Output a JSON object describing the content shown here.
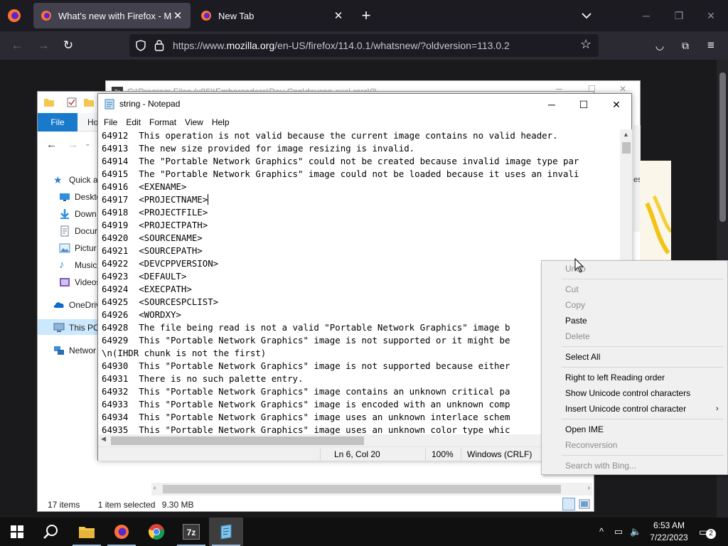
{
  "firefox": {
    "tabs": [
      {
        "title": "What's new with Firefox - More"
      },
      {
        "title": "New Tab"
      }
    ],
    "url_prefix": "https://www.",
    "url_host": "mozilla.org",
    "url_path": "/en-US/firefox/114.0.1/whatsnew/?oldversion=113.0.2"
  },
  "zip": {
    "title": "C:\\Program Files (x86)\\Embarcadero\\Dev-Cpp\\devcpp.exe\\.rsrc\\0\\",
    "icon_text": "7z",
    "side_text": "es"
  },
  "explorer": {
    "file_tab": "File",
    "home_tab": "Ho",
    "nav": [
      {
        "label": "Quick a",
        "icon": "star-icon"
      },
      {
        "label": "Deskto",
        "icon": "desktop-icon"
      },
      {
        "label": "Down",
        "icon": "download-icon"
      },
      {
        "label": "Docur",
        "icon": "documents-icon"
      },
      {
        "label": "Pictur",
        "icon": "pictures-icon"
      },
      {
        "label": "Music",
        "icon": "music-icon"
      },
      {
        "label": "Videos",
        "icon": "videos-icon"
      },
      {
        "label": "OneDriv",
        "icon": "onedrive-icon"
      },
      {
        "label": "This PC",
        "icon": "this-pc-icon"
      },
      {
        "label": "Networ",
        "icon": "network-icon"
      }
    ],
    "status_items": "17 items",
    "status_selected": "1 item selected",
    "status_size": "9.30 MB"
  },
  "notepad": {
    "title": "string - Notepad",
    "menu": [
      "File",
      "Edit",
      "Format",
      "View",
      "Help"
    ],
    "lines": [
      "64912\tThis operation is not valid because the current image contains no valid header.",
      "64913\tThe new size provided for image resizing is invalid.",
      "64914\tThe \"Portable Network Graphics\" could not be created because invalid image type par",
      "64915\tThe \"Portable Network Graphics\" image could not be loaded because it uses an invali",
      "64916\t<EXENAME>",
      "64917\t<PROJECTNAME>",
      "64918\t<PROJECTFILE>",
      "64919\t<PROJECTPATH>",
      "64920\t<SOURCENAME>",
      "64921\t<SOURCEPATH>",
      "64922\t<DEVCPPVERSION>",
      "64923\t<DEFAULT>",
      "64924\t<EXECPATH>",
      "64925\t<SOURCESPCLIST>",
      "64926\t<WORDXY>",
      "64928\tThe file being read is not a valid \"Portable Network Graphics\" image b",
      "64929\tThis \"Portable Network Graphics\" image is not supported or it might be",
      "\\n(IHDR chunk is not the first)",
      "64930\tThis \"Portable Network Graphics\" image is not supported because either",
      "64931\tThere is no such palette entry.",
      "64932\tThis \"Portable Network Graphics\" image contains an unknown critical pa",
      "64933\tThis \"Portable Network Graphics\" image is encoded with an unknown comp",
      "64934\tThis \"Portable Network Graphics\" image uses an unknown interlace schem",
      "64935\tThis \"Portable Network Graphics\" image uses an unknown color type whic"
    ],
    "status_position": "Ln 6, Col 20",
    "status_zoom": "100%",
    "status_eol": "Windows (CRLF)"
  },
  "context_menu": {
    "items": [
      {
        "label": "Undo",
        "enabled": false
      },
      {
        "label": "Cut",
        "enabled": false
      },
      {
        "label": "Copy",
        "enabled": false
      },
      {
        "label": "Paste",
        "enabled": true
      },
      {
        "label": "Delete",
        "enabled": false
      },
      {
        "label": "Select All",
        "enabled": true
      },
      {
        "label": "Right to left Reading order",
        "enabled": true
      },
      {
        "label": "Show Unicode control characters",
        "enabled": true
      },
      {
        "label": "Insert Unicode control character",
        "enabled": true
      },
      {
        "label": "Open IME",
        "enabled": true
      },
      {
        "label": "Reconversion",
        "enabled": false
      },
      {
        "label": "Search with Bing...",
        "enabled": false
      }
    ]
  },
  "taskbar": {
    "time": "6:53 AM",
    "date": "7/22/2023",
    "notification_count": "2",
    "apps": [
      "start-icon",
      "search-icon",
      "file-explorer-icon",
      "firefox-icon",
      "chrome-icon",
      "7zip-icon",
      "notepad-icon"
    ]
  }
}
